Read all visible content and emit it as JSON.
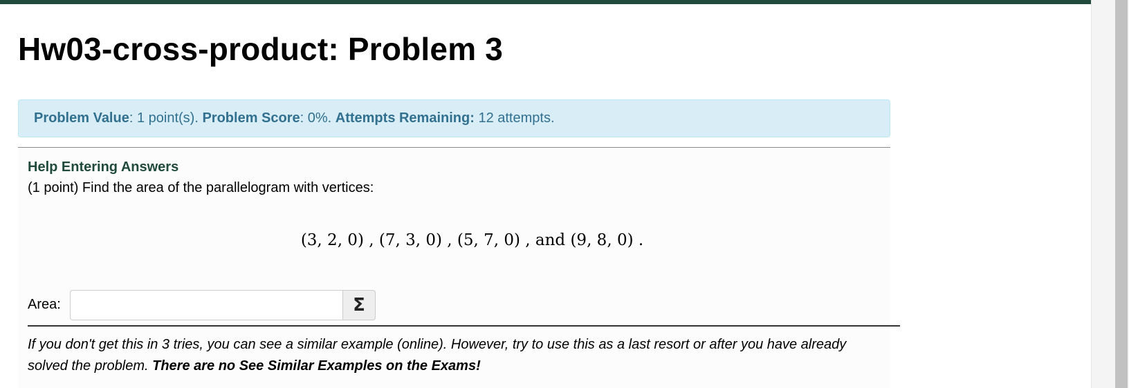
{
  "page": {
    "title": "Hw03-cross-product: Problem 3"
  },
  "info": {
    "value_label": "Problem Value",
    "value_text": ": 1 point(s). ",
    "score_label": "Problem Score",
    "score_text": ": 0%. ",
    "attempts_label": "Attempts Remaining:",
    "attempts_text": " 12 attempts."
  },
  "problem": {
    "help_link": "Help Entering Answers",
    "prompt": "(1 point) Find the area of the parallelogram with vertices:",
    "vertices": "(3, 2, 0) , (7, 3, 0) , (5, 7, 0) , and (9, 8, 0) .",
    "answer_label": "Area:",
    "answer_value": "",
    "sigma_label": "Σ",
    "note_text": "If you don't get this in 3 tries, you can see a similar example (online). However, try to use this as a last resort or after you have already solved the problem. ",
    "note_bold": "There are no See Similar Examples on the Exams!"
  },
  "colors": {
    "topbar": "#1f4a3c",
    "info_bg": "#d9edf7",
    "info_text": "#31708f",
    "help_link": "#1f4a3c"
  },
  "icons": {
    "equation_editor": "sigma-icon"
  }
}
